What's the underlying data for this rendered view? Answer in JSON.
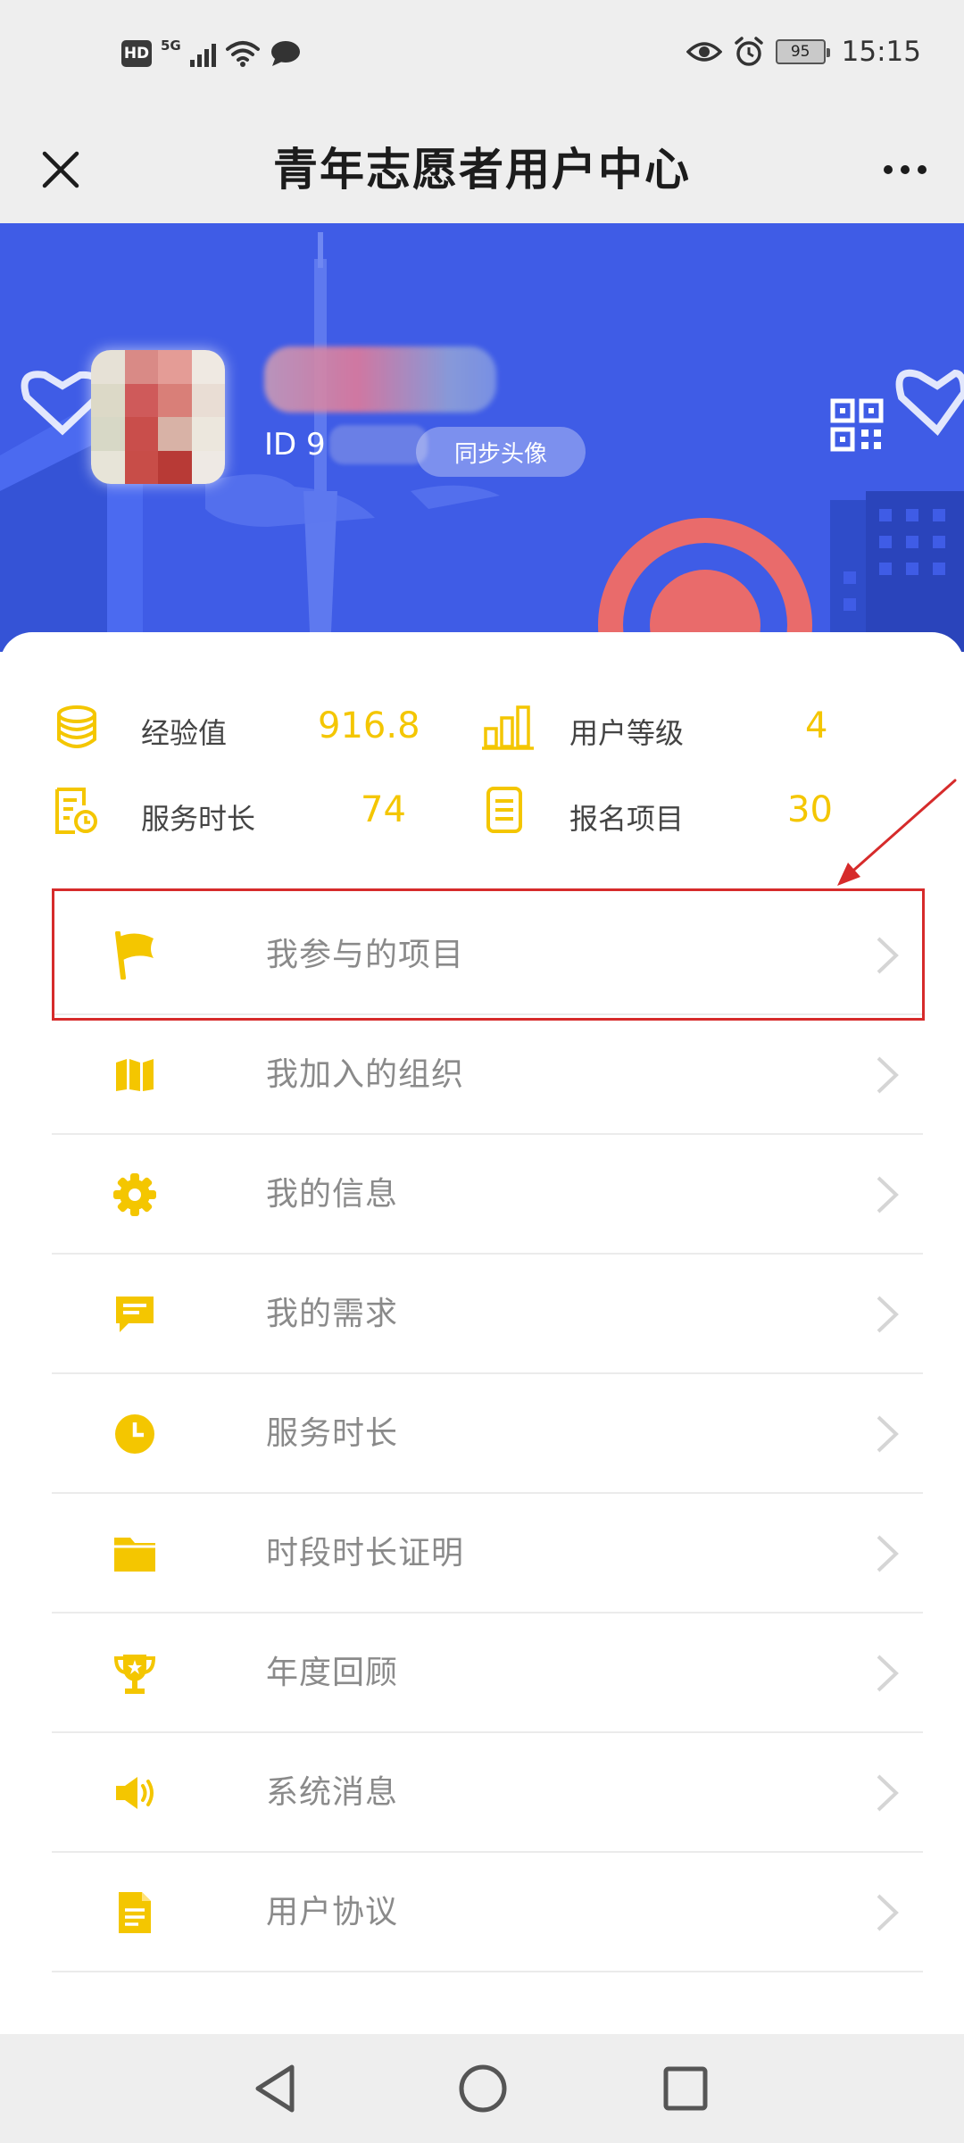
{
  "status_bar": {
    "hd_badge": "HD",
    "network": "5G",
    "battery": "95",
    "time": "15:15"
  },
  "header": {
    "title": "青年志愿者用户中心"
  },
  "profile": {
    "id_label": "ID 9",
    "sync_avatar_label": "同步头像"
  },
  "stats": [
    {
      "label": "经验值",
      "value": "916.8",
      "icon": "coins-icon"
    },
    {
      "label": "用户等级",
      "value": "4",
      "icon": "bar-chart-icon"
    },
    {
      "label": "服务时长",
      "value": "74",
      "icon": "clock-document-icon"
    },
    {
      "label": "报名项目",
      "value": "30",
      "icon": "list-document-icon"
    }
  ],
  "menu": [
    {
      "label": "我参与的项目",
      "icon": "flag-icon"
    },
    {
      "label": "我加入的组织",
      "icon": "map-icon"
    },
    {
      "label": "我的信息",
      "icon": "gear-icon"
    },
    {
      "label": "我的需求",
      "icon": "message-icon"
    },
    {
      "label": "服务时长",
      "icon": "clock-icon"
    },
    {
      "label": "时段时长证明",
      "icon": "folder-icon"
    },
    {
      "label": "年度回顾",
      "icon": "trophy-icon"
    },
    {
      "label": "系统消息",
      "icon": "speaker-icon"
    },
    {
      "label": "用户协议",
      "icon": "document-icon"
    }
  ],
  "colors": {
    "accent": "#f4c600",
    "banner": "#3f5ce6",
    "highlight": "#d62b2b"
  }
}
